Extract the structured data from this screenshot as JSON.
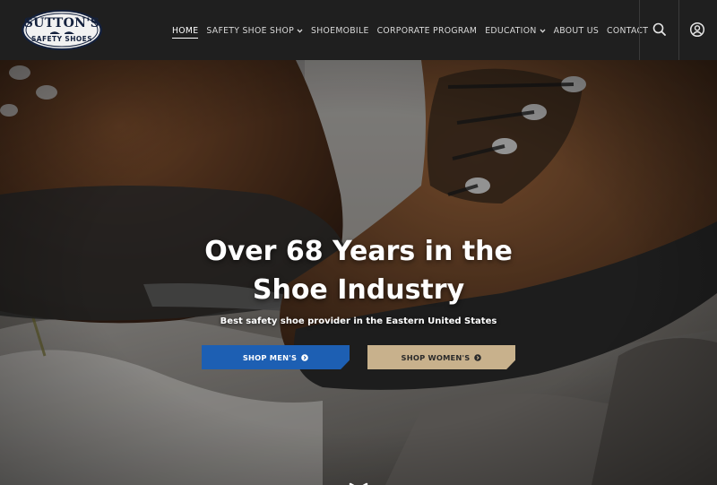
{
  "logo": {
    "line1": "SUTTON'S",
    "line2": "SAFETY SHOES"
  },
  "nav": {
    "items": [
      {
        "label": "HOME",
        "active": true,
        "has_dropdown": false
      },
      {
        "label": "SAFETY SHOE SHOP",
        "active": false,
        "has_dropdown": true
      },
      {
        "label": "SHOEMOBILE",
        "active": false,
        "has_dropdown": false
      },
      {
        "label": "CORPORATE PROGRAM",
        "active": false,
        "has_dropdown": false
      },
      {
        "label": "EDUCATION",
        "active": false,
        "has_dropdown": true
      },
      {
        "label": "ABOUT US",
        "active": false,
        "has_dropdown": false
      },
      {
        "label": "CONTACT",
        "active": false,
        "has_dropdown": false
      }
    ]
  },
  "header_icons": {
    "search": "search-icon",
    "account": "user-account-icon"
  },
  "hero": {
    "title_line1": "Over 68 Years in the",
    "title_line2": "Shoe Industry",
    "subtitle": "Best safety shoe provider in the Eastern United States",
    "background": "hiking-boots-on-rocks-photo",
    "buttons": {
      "men_label": "SHOP MEN'S",
      "women_label": "SHOP WOMEN'S"
    }
  },
  "colors": {
    "header_bg": "#1f1f1f",
    "accent_blue": "#1d5fb3",
    "accent_tan": "#c8b18c",
    "logo_navy": "#14213d"
  }
}
